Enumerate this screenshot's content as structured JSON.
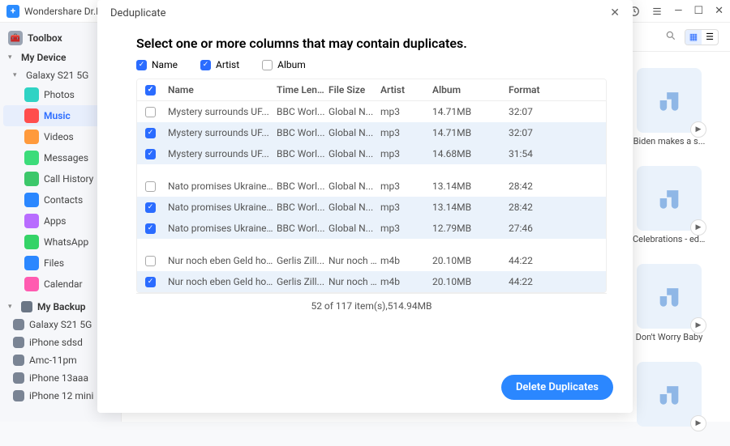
{
  "titlebar": {
    "app": "Wondershare Dr.Fon"
  },
  "sidebar": {
    "toolbox": "Toolbox",
    "myDevice": "My Device",
    "device": "Galaxy S21 5G",
    "items": [
      {
        "label": "Photos",
        "color": "#2fd3c4"
      },
      {
        "label": "Music",
        "color": "#ff4d4d",
        "selected": true
      },
      {
        "label": "Videos",
        "color": "#ff9a3c"
      },
      {
        "label": "Messages",
        "color": "#3cdc7a"
      },
      {
        "label": "Call History",
        "color": "#3cc76a"
      },
      {
        "label": "Contacts",
        "color": "#2b87ff"
      },
      {
        "label": "Apps",
        "color": "#b86cff"
      },
      {
        "label": "WhatsApp",
        "color": "#34d367"
      },
      {
        "label": "Files",
        "color": "#2b87ff"
      },
      {
        "label": "Calendar",
        "color": "#ff5bb0"
      }
    ],
    "myBackup": "My Backup",
    "backups": [
      "Galaxy S21 5G",
      "iPhone  sdsd",
      "Amc-11pm",
      "iPhone 13aaa",
      "iPhone 12 mini"
    ]
  },
  "cards": [
    {
      "label": "Biden makes a s..."
    },
    {
      "label": "Celebrations - ed..."
    },
    {
      "label": "Don't Worry Baby"
    },
    {
      "label": ""
    }
  ],
  "modal": {
    "title": "Deduplicate",
    "subtitle": "Select one or more columns that may contain duplicates.",
    "colChecks": [
      {
        "label": "Name",
        "state": "on"
      },
      {
        "label": "Artist",
        "state": "on"
      },
      {
        "label": "Album",
        "state": "off"
      }
    ],
    "headers": [
      "",
      "Name",
      "Time Len...",
      "File Size",
      "Artist",
      "Album",
      "Format"
    ],
    "rows": [
      {
        "chk": false,
        "cells": [
          "Mystery surrounds UF...",
          "BBC Worl...",
          "Global N...",
          "mp3",
          "14.71MB",
          "32:07"
        ]
      },
      {
        "chk": true,
        "cells": [
          "Mystery surrounds UF...",
          "BBC Worl...",
          "Global N...",
          "mp3",
          "14.71MB",
          "32:07"
        ],
        "sel": true
      },
      {
        "chk": true,
        "cells": [
          "Mystery surrounds UF...",
          "BBC Worl...",
          "Global N...",
          "mp3",
          "14.68MB",
          "31:54"
        ],
        "sel": true
      },
      {
        "gap": true
      },
      {
        "chk": false,
        "cells": [
          "Nato promises Ukraine...",
          "BBC Worl...",
          "Global N...",
          "mp3",
          "13.14MB",
          "28:42"
        ]
      },
      {
        "chk": true,
        "cells": [
          "Nato promises Ukraine...",
          "BBC Worl...",
          "Global N...",
          "mp3",
          "13.14MB",
          "28:42"
        ],
        "sel": true
      },
      {
        "chk": true,
        "cells": [
          "Nato promises Ukraine...",
          "BBC Worl...",
          "Global N...",
          "mp3",
          "12.79MB",
          "27:46"
        ],
        "sel": true
      },
      {
        "gap": true
      },
      {
        "chk": false,
        "cells": [
          "Nur noch eben Geld ho...",
          "Gerlis Zill...",
          "Nur noch ...",
          "m4b",
          "20.10MB",
          "44:22"
        ]
      },
      {
        "chk": true,
        "cells": [
          "Nur noch eben Geld ho...",
          "Gerlis Zill...",
          "Nur noch ...",
          "m4b",
          "20.10MB",
          "44:22"
        ],
        "sel": true
      }
    ],
    "status": "52 of 117 item(s),514.94MB",
    "action": "Delete Duplicates"
  }
}
